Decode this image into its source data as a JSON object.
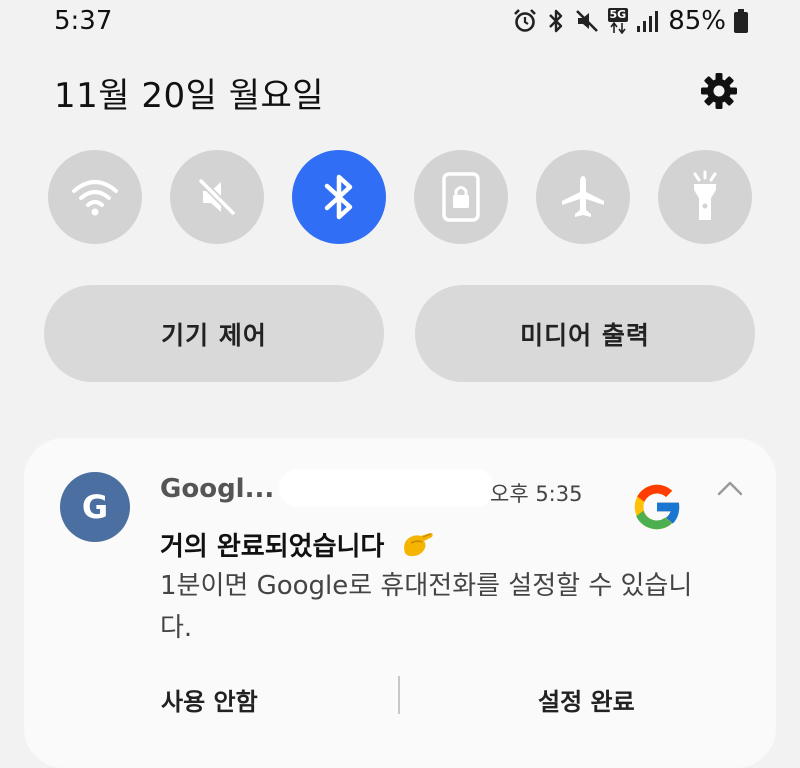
{
  "status_bar": {
    "time": "5:37",
    "network_badge": "5G",
    "battery_percent": "85%",
    "icons": [
      "alarm-icon",
      "bluetooth-icon",
      "mute-icon",
      "5g-icon",
      "signal-icon",
      "battery-icon"
    ]
  },
  "header": {
    "date": "11월 20일 월요일",
    "settings_icon": "gear-icon"
  },
  "quick_settings": {
    "tiles": [
      {
        "name": "wifi",
        "icon": "wifi-icon",
        "active": false
      },
      {
        "name": "sound",
        "icon": "mute-icon",
        "active": false
      },
      {
        "name": "bluetooth",
        "icon": "bluetooth-icon",
        "active": true
      },
      {
        "name": "rotation-lock",
        "icon": "lock-icon",
        "active": false
      },
      {
        "name": "airplane-mode",
        "icon": "airplane-icon",
        "active": false
      },
      {
        "name": "flashlight",
        "icon": "flashlight-icon",
        "active": false
      }
    ],
    "accent_color": "#2f6ef5",
    "inactive_color": "#d3d3d3"
  },
  "controls": {
    "device_control_label": "기기 제어",
    "media_output_label": "미디어 출력"
  },
  "notification": {
    "app_initial": "G",
    "app_name": "Googl...",
    "time": "오후 5:35",
    "title": "거의 완료되었습니다",
    "body": "1분이면 Google로 휴대전화를 설정할 수 있습니다.",
    "actions": {
      "dismiss_label": "사용 안함",
      "confirm_label": "설정 완료"
    },
    "avatar_color": "#4a6fa0"
  }
}
